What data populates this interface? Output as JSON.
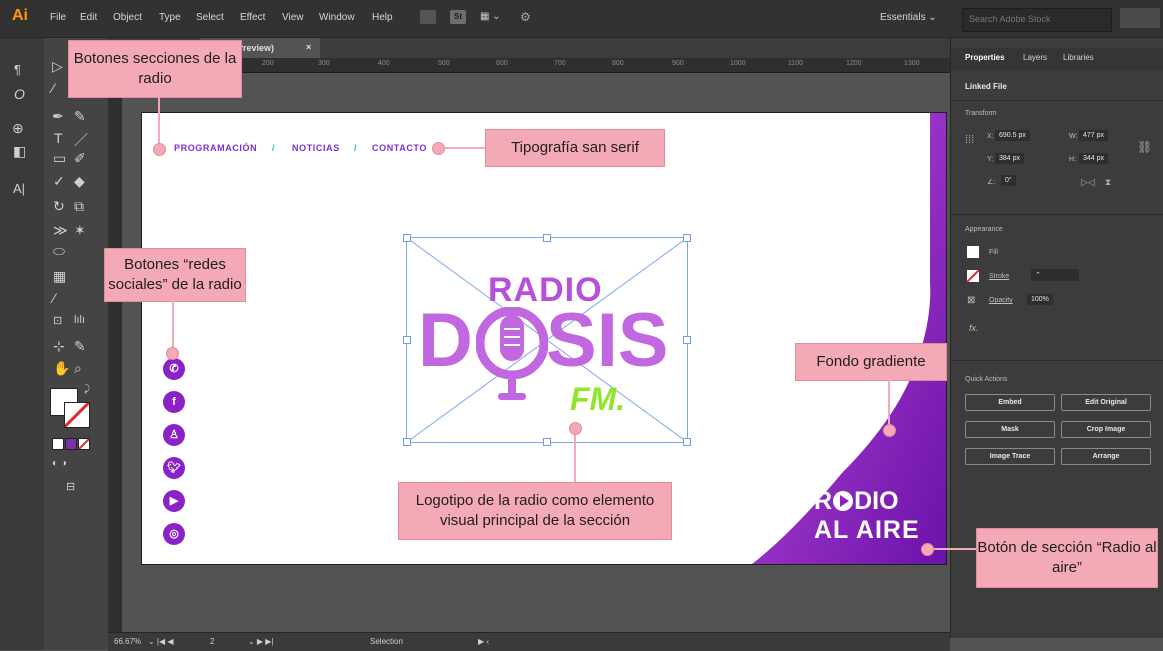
{
  "app": {
    "logo": "Ai"
  },
  "menu": {
    "items": [
      "File",
      "Edit",
      "Object",
      "Type",
      "Select",
      "Effect",
      "View",
      "Window",
      "Help"
    ],
    "st_badge": "St",
    "workspace": "Essentials",
    "search_placeholder": "Search Adobe Stock"
  },
  "document": {
    "tab_label": "B/Preview)",
    "tab_close": "×"
  },
  "ruler": {
    "h_ticks": [
      "200",
      "300",
      "400",
      "500",
      "600",
      "700",
      "800",
      "900",
      "1000",
      "1100",
      "1200",
      "1300"
    ]
  },
  "toolbar": {
    "type_tool": "T",
    "graph_tool": "lılı"
  },
  "artboard": {
    "nav": [
      "PROGRAMACIÓN",
      "NOTICIAS",
      "CONTACTO"
    ],
    "nav_separator": "/",
    "logo": {
      "top": "RADIO",
      "left": "D",
      "right": "SIS",
      "suffix": "FM."
    },
    "radio_al_aire": {
      "line1_a": "R",
      "line1_b": "DIO",
      "line2": "AL AIRE"
    },
    "social_icons": [
      "whatsapp-icon",
      "facebook-icon",
      "snapchat-icon",
      "twitter-icon",
      "youtube-icon",
      "instagram-icon"
    ]
  },
  "status": {
    "zoom": "66.67%",
    "page": "2",
    "tool": "Selection"
  },
  "properties": {
    "tabs": [
      "Properties",
      "Layers",
      "Libraries"
    ],
    "linked_file": "Linked File",
    "transform": {
      "label": "Transform",
      "x_label": "X:",
      "x": "690.5 px",
      "y_label": "Y:",
      "y": "384 px",
      "w_label": "W:",
      "w": "477 px",
      "h_label": "H:",
      "h": "344 px",
      "angle": "0°"
    },
    "appearance": {
      "label": "Appearance",
      "fill": "Fill",
      "stroke": "Stroke",
      "opacity": "Opacity",
      "opacity_value": "100%",
      "fx": "fx."
    },
    "quick_actions": {
      "label": "Quick Actions",
      "buttons": [
        "Embed",
        "Edit Original",
        "Mask",
        "Crop Image",
        "Image Trace",
        "Arrange"
      ]
    }
  },
  "annotations": {
    "secciones": "Botones secciones de la radio",
    "tipografia": "Tipografía san serif",
    "redes": "Botones “redes sociales” de la radio",
    "fondo": "Fondo gradiente",
    "logotipo": "Logotipo de la radio como elemento visual principal de la sección",
    "boton_aire": "Botón de sección “Radio al aire”"
  },
  "colors": {
    "accent_purple": "#8a22c8",
    "logo_violet": "#c167e0",
    "fm_green": "#8ee62b",
    "callout_pink": "#f4a9b6",
    "ai_orange": "#ff9a00"
  }
}
